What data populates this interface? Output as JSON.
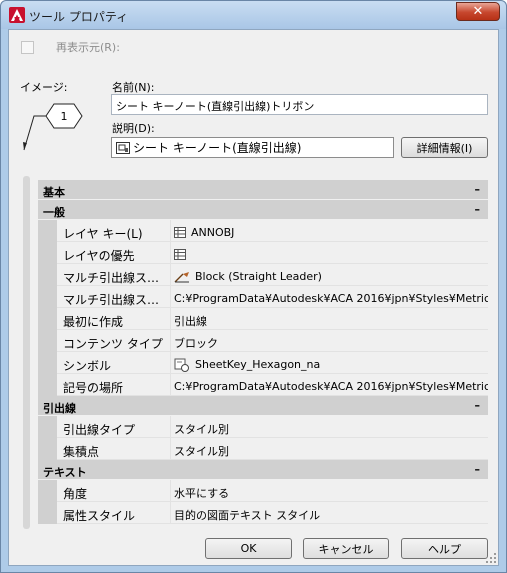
{
  "window": {
    "title": "ツール プロパティ",
    "close_symbol": "✕"
  },
  "refresh": {
    "label": "再表示元(R):",
    "checked": false
  },
  "image": {
    "label": "イメージ:",
    "preview_number": "1"
  },
  "name": {
    "label": "名前(N):",
    "value": "シート キーノート(直線引出線)トリボン"
  },
  "description": {
    "label": "説明(D):",
    "value": "シート キーノート(直線引出線)"
  },
  "detail_button": "詳細情報(I)",
  "property_grid": {
    "categories": [
      {
        "name": "基本",
        "collapse_symbol": "–",
        "rows": []
      },
      {
        "name": "一般",
        "collapse_symbol": "–",
        "rows": [
          {
            "key": "レイヤ キー(L)",
            "value": "ANNOBJ",
            "icon": "grid-icon"
          },
          {
            "key": "レイヤの優先",
            "value": "",
            "icon": "grid-icon"
          },
          {
            "key": "マルチ引出線ス…",
            "value": "Block (Straight Leader)",
            "icon": "leader-style-icon"
          },
          {
            "key": "マルチ引出線ス…",
            "value": "C:¥ProgramData¥Autodesk¥ACA 2016¥jpn¥Styles¥Metric…",
            "icon": ""
          },
          {
            "key": "最初に作成",
            "value": "引出線",
            "icon": ""
          },
          {
            "key": "コンテンツ タイプ",
            "value": "ブロック",
            "icon": ""
          },
          {
            "key": "シンボル",
            "value": "SheetKey_Hexagon_na",
            "icon": "symbol-icon"
          },
          {
            "key": "記号の場所",
            "value": "C:¥ProgramData¥Autodesk¥ACA 2016¥jpn¥Styles¥Metric…",
            "icon": ""
          }
        ]
      },
      {
        "name": "引出線",
        "collapse_symbol": "–",
        "rows": [
          {
            "key": "引出線タイプ",
            "value": "スタイル別",
            "icon": ""
          },
          {
            "key": "集積点",
            "value": "スタイル別",
            "icon": ""
          }
        ]
      },
      {
        "name": "テキスト",
        "collapse_symbol": "–",
        "rows": [
          {
            "key": "角度",
            "value": "水平にする",
            "icon": ""
          },
          {
            "key": "属性スタイル",
            "value": "目的の図面テキスト スタイル",
            "icon": ""
          }
        ]
      }
    ]
  },
  "footer": {
    "ok": "OK",
    "cancel": "キャンセル",
    "help": "ヘルプ"
  },
  "colors": {
    "category_bg": "#d0d0d0",
    "dialog_bg": "#f0f0f0",
    "close_red": "#c7472e"
  }
}
